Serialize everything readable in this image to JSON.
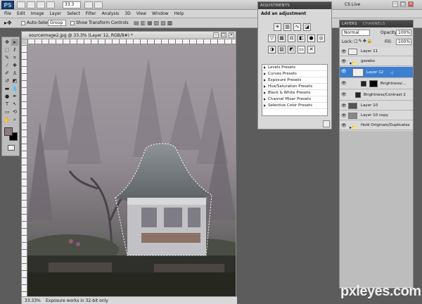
{
  "app": {
    "logo": "PS",
    "zoom": "33.3",
    "cs_live": "CS Live"
  },
  "menu": [
    "File",
    "Edit",
    "Image",
    "Layer",
    "Select",
    "Filter",
    "Analysis",
    "3D",
    "View",
    "Window",
    "Help"
  ],
  "options_bar": {
    "auto_select": "Auto-Select:",
    "auto_select_value": "Group",
    "show_transform": "Show Transform Controls"
  },
  "document": {
    "title": "sourceimage2.jpg @ 33.3% (Layer 12, RGB/8#) *",
    "zoom": "33.33%",
    "status": "Exposure works in 32-bit only"
  },
  "adjustments": {
    "tab": "ADJUSTMENTS",
    "heading": "Add an adjustment",
    "presets": [
      "Levels Presets",
      "Curves Presets",
      "Exposure Presets",
      "Hue/Saturation Presets",
      "Black & White Presets",
      "Channel Mixer Presets",
      "Selective Color Presets"
    ]
  },
  "layers": {
    "tabs": [
      "LAYERS",
      "CHANNELS"
    ],
    "blend_mode": "Normal",
    "opacity_label": "Opacity:",
    "opacity": "100%",
    "lock_label": "Lock:",
    "fill_label": "Fill:",
    "fill": "100%",
    "rows": [
      "Layer 11",
      "gazebo",
      "Layer 12",
      "Brightness/...",
      "Brightness/Contrast 2",
      "Layer 10",
      "Layer 10 copy",
      "Hold Originals/Duplicates"
    ]
  },
  "watermark": "pxleyes.com"
}
